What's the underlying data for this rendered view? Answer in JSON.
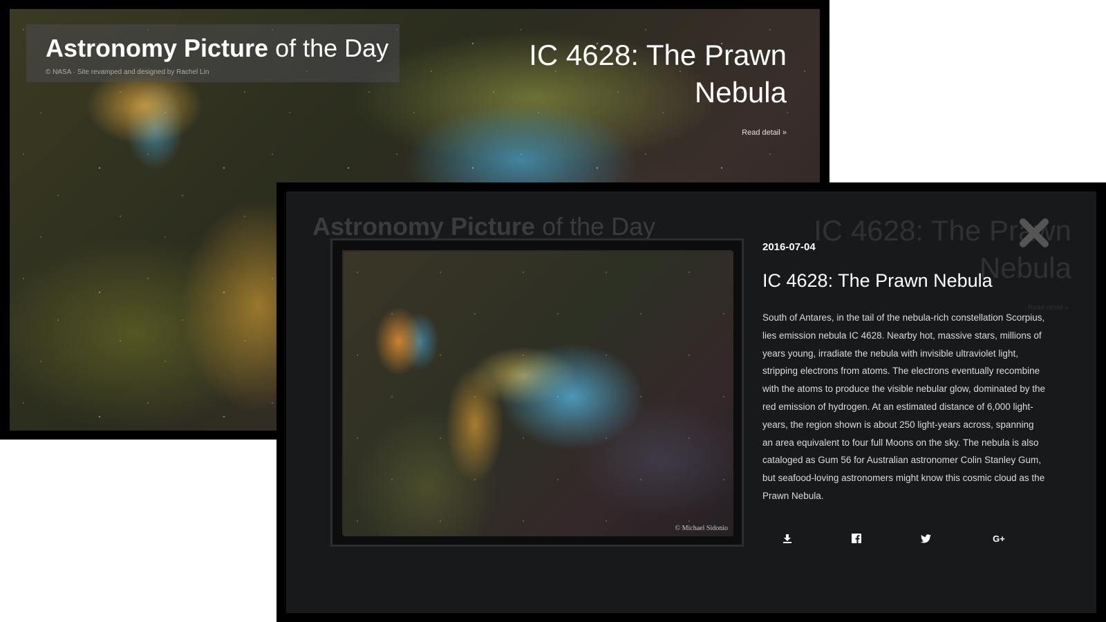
{
  "site": {
    "brand_bold": "Astronomy Picture",
    "brand_light": " of the Day",
    "credit": "© NASA · Site revamped and designed by Rachel Lin"
  },
  "hero": {
    "title": "IC 4628: The Prawn Nebula",
    "read_detail": "Read detail »"
  },
  "modal": {
    "date": "2016-07-04",
    "title": "IC 4628: The Prawn Nebula",
    "description": "South of Antares, in the tail of the nebula-rich constellation Scorpius, lies emission nebula IC 4628. Nearby hot, massive stars, millions of years young, irradiate the nebula with invisible ultraviolet light, stripping electrons from atoms. The electrons eventually recombine with the atoms to produce the visible nebular glow, dominated by the red emission of hydrogen. At an estimated distance of 6,000 light-years, the region shown is about 250 light-years across, spanning an area equivalent to four full Moons on the sky. The nebula is also cataloged as Gum 56 for Australian astronomer Colin Stanley Gum, but seafood-loving astronomers might know this cosmic cloud as the Prawn Nebula.",
    "photo_credit": "© Michael Sidonio",
    "share_icons": [
      "download-icon",
      "facebook-icon",
      "twitter-icon",
      "google-plus-icon"
    ],
    "google_plus_label": "G+"
  },
  "colors": {
    "page_bg": "#ffffff",
    "modal_bg": "#17191b",
    "text": "#dcdcdc",
    "close": "#555555"
  }
}
